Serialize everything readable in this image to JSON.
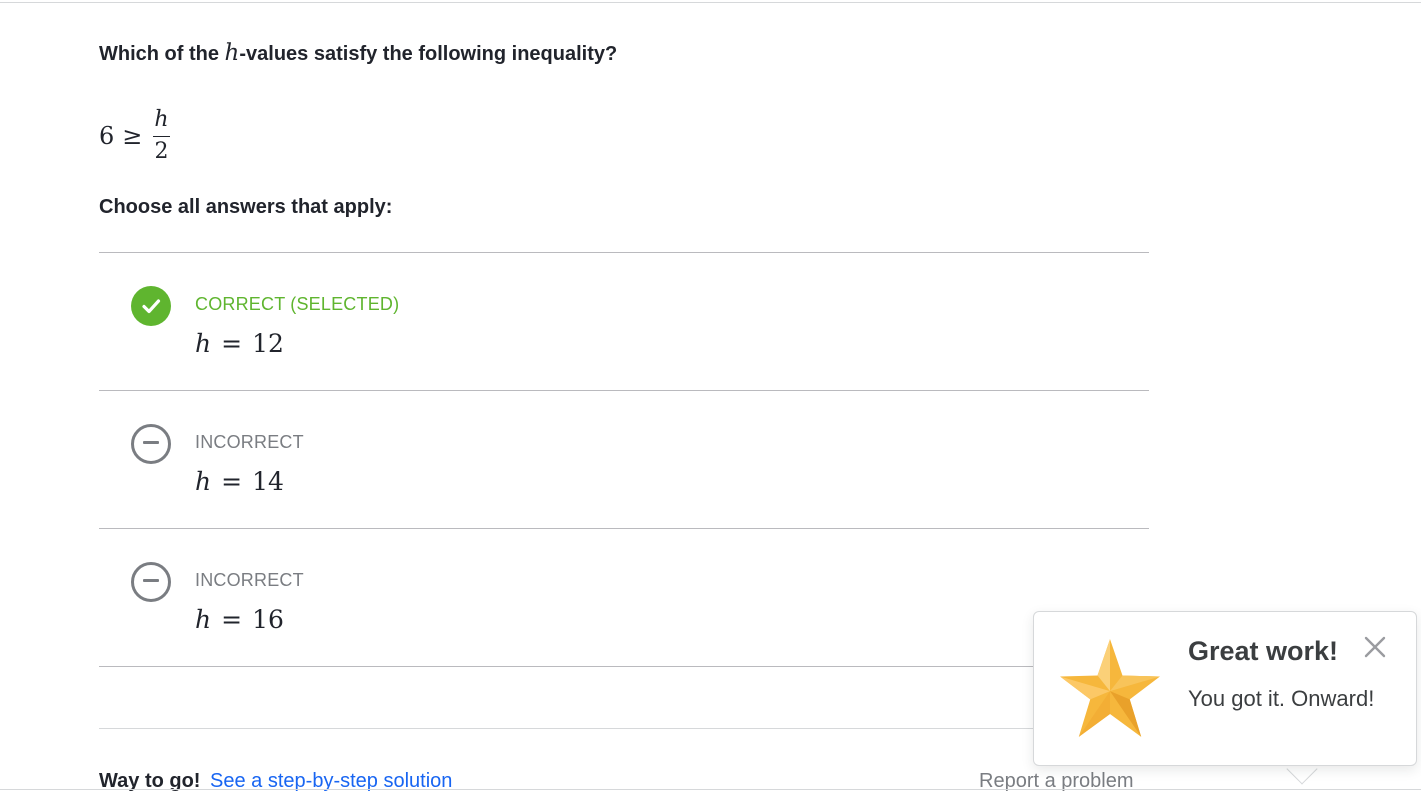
{
  "question": {
    "prefix": "Which of the ",
    "variable": "h",
    "suffix": "-values satisfy the following inequality?"
  },
  "inequality": {
    "left": "6",
    "operator": "≥",
    "numerator": "h",
    "denominator": "2"
  },
  "instructions": "Choose all answers that apply:",
  "choices": [
    {
      "status": "CORRECT (SELECTED)",
      "variable": "h",
      "equals": "=",
      "value": "12",
      "icon": "check-icon",
      "status_color": "#5fb52f"
    },
    {
      "status": "INCORRECT",
      "variable": "h",
      "equals": "=",
      "value": "14",
      "icon": "minus-circle-icon",
      "status_color": "#7a7d82"
    },
    {
      "status": "INCORRECT",
      "variable": "h",
      "equals": "=",
      "value": "16",
      "icon": "minus-circle-icon",
      "status_color": "#7a7d82"
    }
  ],
  "footer": {
    "way_to_go": "Way to go!",
    "solution_link": "See a step-by-step solution",
    "report_link": "Report a problem"
  },
  "toast": {
    "title": "Great work!",
    "message": "You got it. Onward!",
    "icon": "star-icon",
    "close_icon": "close-icon"
  },
  "colors": {
    "correct_green": "#5fb52f",
    "incorrect_gray": "#7a7d82",
    "link_blue": "#1865f2",
    "star_gold": "#f6b73c"
  }
}
